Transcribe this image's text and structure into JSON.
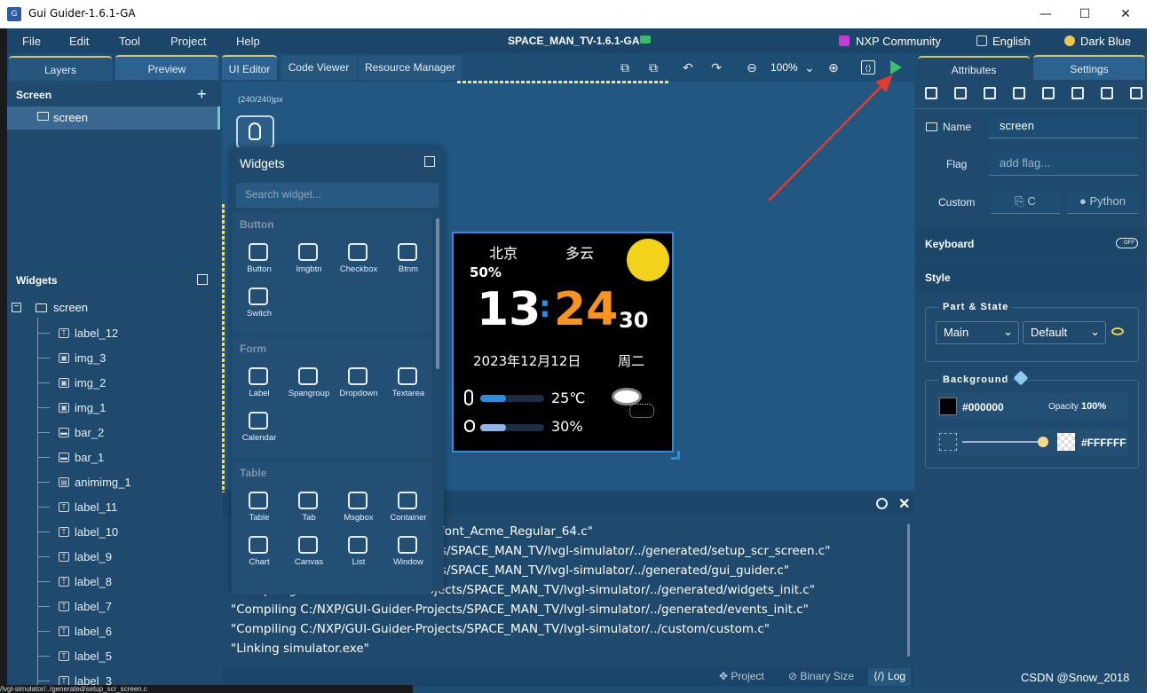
{
  "window": {
    "title": "Gui Guider-1.6.1-GA",
    "min": "—",
    "max": "☐",
    "close": "✕"
  },
  "menu": {
    "items": [
      "File",
      "Edit",
      "Tool",
      "Project",
      "Help"
    ],
    "project_title": "SPACE_MAN_TV-1.6.1-GA",
    "community": "NXP Community",
    "language": "English",
    "theme": "Dark Blue"
  },
  "left_tabs": [
    "Layers",
    "Preview"
  ],
  "center_tabs": [
    "UI Editor",
    "Code Viewer",
    "Resource Manager"
  ],
  "zoom": "100%",
  "screen_section": {
    "title": "Screen",
    "add": "+",
    "item": "screen"
  },
  "widgets_section": {
    "title": "Widgets",
    "root": "screen",
    "items": [
      "label_12",
      "img_3",
      "img_2",
      "img_1",
      "bar_2",
      "bar_1",
      "animimg_1",
      "label_11",
      "label_10",
      "label_9",
      "label_8",
      "label_7",
      "label_6",
      "label_5",
      "label_3"
    ]
  },
  "canvas": {
    "size_label": "(240/240)px"
  },
  "widgets_panel": {
    "title": "Widgets",
    "search_placeholder": "Search widget...",
    "categories": [
      {
        "name": "Button",
        "items": [
          "Button",
          "Imgbtn",
          "Checkbox",
          "Btnm",
          "Switch"
        ]
      },
      {
        "name": "Form",
        "items": [
          "Label",
          "Spangroup",
          "Dropdown",
          "Textarea",
          "Calendar"
        ]
      },
      {
        "name": "Table",
        "items": [
          "Table",
          "Tab",
          "Msgbox",
          "Container",
          "Chart",
          "Canvas",
          "List",
          "Window"
        ]
      }
    ]
  },
  "device": {
    "city": "北京",
    "weather": "多云",
    "percent_top": "50%",
    "hour": "13",
    "colon": ":",
    "minute": "24",
    "second": "30",
    "date": "2023年12月12日",
    "weekday": "周二",
    "temperature": "25℃",
    "humidity": "30%",
    "temp_bar_fraction": 0.4,
    "humidity_bar_fraction": 0.4,
    "colors": {
      "minute": "#f7941d",
      "sun": "#f3d21c",
      "colon": "#2c8ce0",
      "temp_bar": "#2c8ce0",
      "hum_bar": "#8fb4e8"
    }
  },
  "log": {
    "lines": [
      "font_Acme_Regular_64.c\"",
      "s/SPACE_MAN_TV/lvgl-simulator/../generated/setup_scr_screen.c\"",
      "s/SPACE_MAN_TV/lvgl-simulator/../generated/gui_guider.c\"",
      "\"Compiling C:/NXP/GUI-Guider-Projects/SPACE_MAN_TV/lvgl-simulator/../generated/widgets_init.c\"",
      "\"Compiling C:/NXP/GUI-Guider-Projects/SPACE_MAN_TV/lvgl-simulator/../generated/events_init.c\"",
      "\"Compiling C:/NXP/GUI-Guider-Projects/SPACE_MAN_TV/lvgl-simulator/../custom/custom.c\"",
      "\"Linking simulator.exe\""
    ],
    "tabs": [
      "Project",
      "Binary Size",
      "Log"
    ],
    "bottom_path": "/lvgl-simulator/../generated/setup_scr_screen.c"
  },
  "right_panel": {
    "tabs": [
      "Attributes",
      "Settings"
    ],
    "name_label": "Name",
    "name_value": "screen",
    "flag_label": "Flag",
    "flag_placeholder": "add flag...",
    "custom_label": "Custom",
    "custom_c": "C",
    "custom_python": "Python",
    "keyboard_label": "Keyboard",
    "keyboard_toggle": "OFF",
    "style_label": "Style",
    "part_state_title": "Part & State",
    "part_value": "Main",
    "state_value": "Default",
    "background_title": "Background",
    "bg_color": "#000000",
    "opacity_label": "Opacity",
    "opacity_value": "100%",
    "gradient_color": "#FFFFFF"
  },
  "watermark": "CSDN @Snow_2018"
}
